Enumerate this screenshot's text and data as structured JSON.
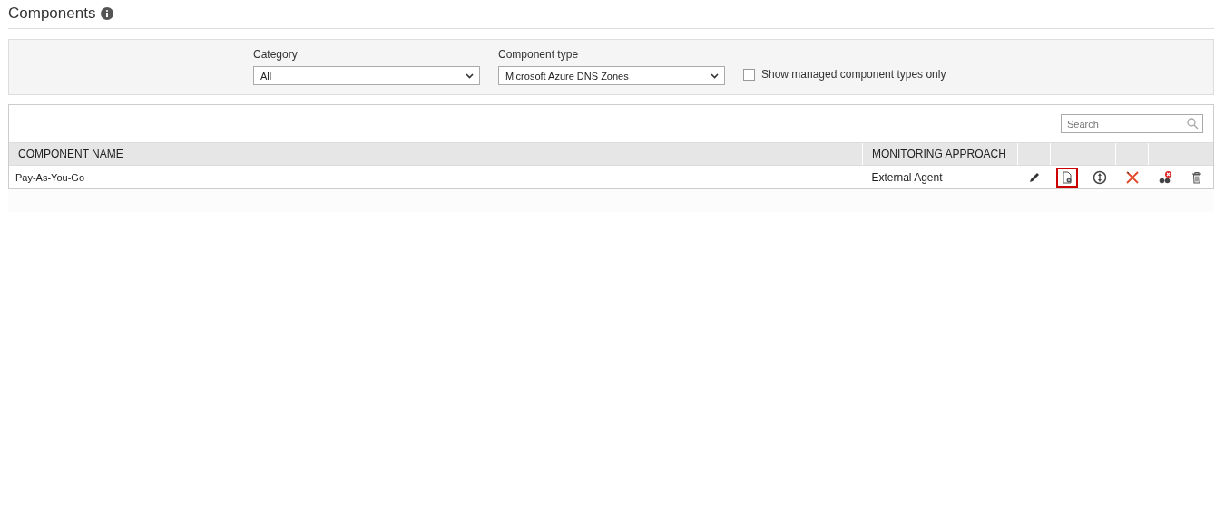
{
  "page": {
    "title": "Components"
  },
  "filters": {
    "category": {
      "label": "Category",
      "value": "All"
    },
    "component_type": {
      "label": "Component type",
      "value": "Microsoft Azure DNS Zones"
    },
    "managed_only": {
      "label": "Show managed component types only",
      "checked": false
    }
  },
  "search": {
    "placeholder": "Search"
  },
  "table": {
    "columns": [
      "COMPONENT NAME",
      "MONITORING APPROACH"
    ],
    "rows": [
      {
        "name": "Pay-As-You-Go",
        "approach": "External Agent",
        "actions": [
          {
            "kind": "edit",
            "selected": false
          },
          {
            "kind": "config",
            "selected": true
          },
          {
            "kind": "move",
            "selected": false
          },
          {
            "kind": "tools",
            "selected": false
          },
          {
            "kind": "unmanage",
            "selected": false
          },
          {
            "kind": "delete",
            "selected": false
          }
        ]
      }
    ]
  }
}
